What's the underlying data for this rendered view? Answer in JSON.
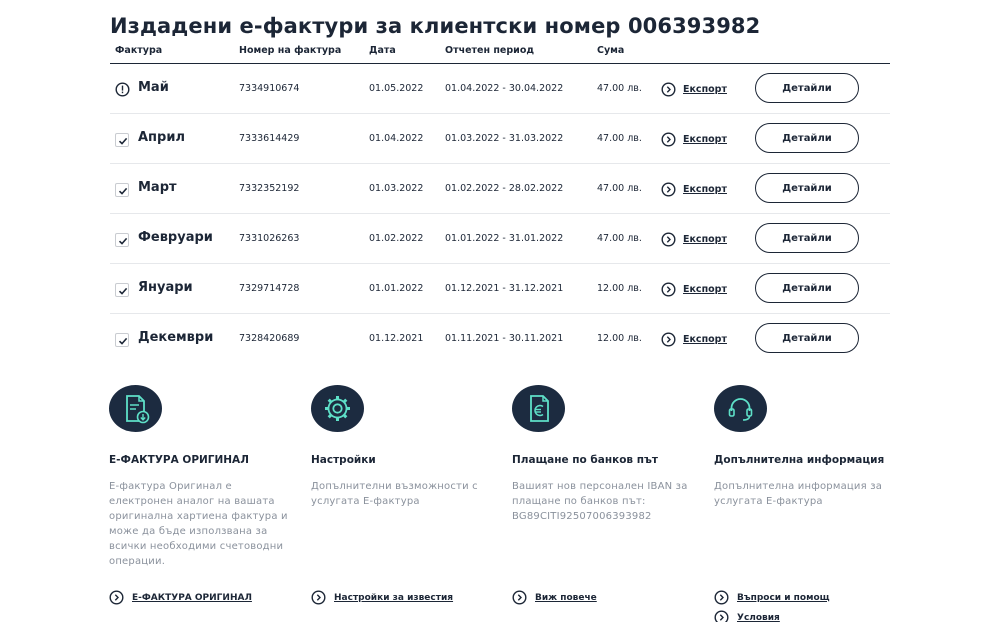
{
  "title": "Издадени е-фактури за клиентски номер 006393982",
  "table": {
    "headers": [
      "Фактура",
      "Номер на фактура",
      "Дата",
      "Отчетен период",
      "Сума"
    ],
    "export_label": "Експорт",
    "details_label": "Детайли",
    "rows": [
      {
        "month": "Май",
        "status": "info",
        "number": "7334910674",
        "date": "01.05.2022",
        "period": "01.04.2022 - 30.04.2022",
        "amount": "47.00 лв."
      },
      {
        "month": "Април",
        "status": "paid",
        "number": "7333614429",
        "date": "01.04.2022",
        "period": "01.03.2022 - 31.03.2022",
        "amount": "47.00 лв."
      },
      {
        "month": "Март",
        "status": "paid",
        "number": "7332352192",
        "date": "01.03.2022",
        "period": "01.02.2022 - 28.02.2022",
        "amount": "47.00 лв."
      },
      {
        "month": "Февруари",
        "status": "paid",
        "number": "7331026263",
        "date": "01.02.2022",
        "period": "01.01.2022 - 31.01.2022",
        "amount": "47.00 лв."
      },
      {
        "month": "Януари",
        "status": "paid",
        "number": "7329714728",
        "date": "01.01.2022",
        "period": "01.12.2021 - 31.12.2021",
        "amount": "12.00 лв."
      },
      {
        "month": "Декември",
        "status": "paid",
        "number": "7328420689",
        "date": "01.12.2021",
        "period": "01.11.2021 - 30.11.2021",
        "amount": "12.00 лв."
      }
    ]
  },
  "info": [
    {
      "icon": "document-download-icon",
      "title": "Е-ФАКТУРА ОРИГИНАЛ",
      "text": "Е-фактура Оригинал е електронен аналог на вашата оригинална хартиена фактура и може да бъде използвана за всички необходими счетоводни операции.",
      "links": [
        "Е-ФАКТУРА ОРИГИНАЛ"
      ]
    },
    {
      "icon": "gear-icon",
      "title": "Настройки",
      "text": "Допълнителни възможности с услугата Е-фактура",
      "links": [
        "Настройки за известия"
      ]
    },
    {
      "icon": "euro-document-icon",
      "title": "Плащане по банков път",
      "text": "Вашият нов персонален IBAN за плащане по банков път: BG89CITI92507006393982",
      "links": [
        "Виж повече"
      ]
    },
    {
      "icon": "headset-icon",
      "title": "Допълнителна информация",
      "text": "Допълнителна информация за услугата Е-фактура",
      "links": [
        "Въпроси и помощ",
        "Условия"
      ]
    }
  ],
  "colors": {
    "dark": "#1c2636",
    "icon_bg": "#1c2b40",
    "accent": "#5ee0c8",
    "muted_text": "#8a919c",
    "divider": "#e6e8eb"
  }
}
